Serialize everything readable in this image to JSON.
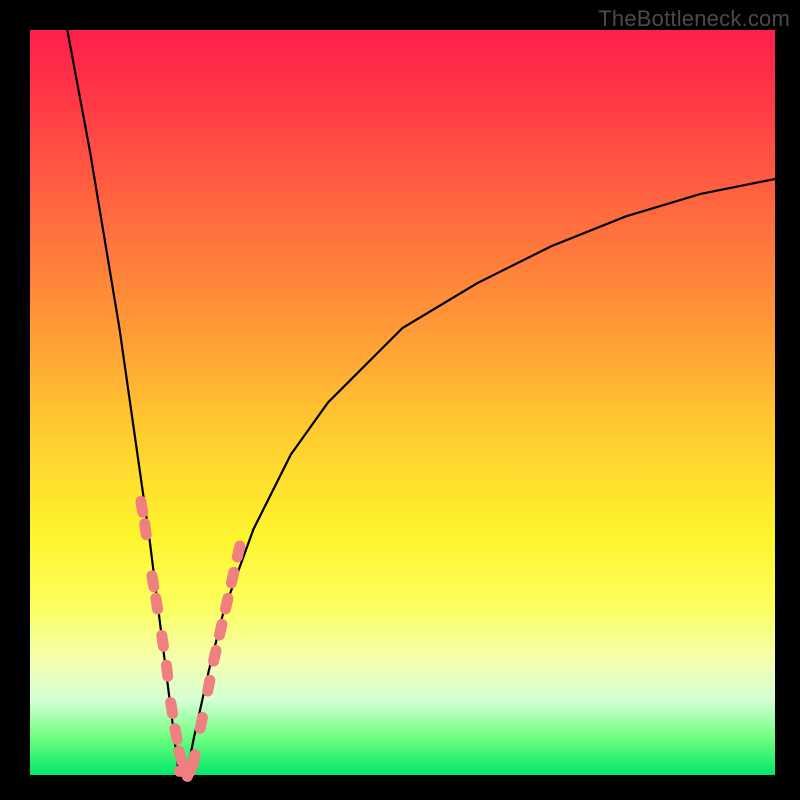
{
  "watermark": "TheBottleneck.com",
  "colors": {
    "frame": "#000000",
    "marker": "#f08080",
    "curve": "#000000",
    "gradient_top": "#ff1f4b",
    "gradient_bottom": "#00e66b"
  },
  "chart_data": {
    "type": "line",
    "title": "",
    "xlabel": "",
    "ylabel": "",
    "xlim": [
      0,
      100
    ],
    "ylim": [
      0,
      100
    ],
    "grid": false,
    "legend": false,
    "note": "V-shaped bottleneck curve; minimum at x≈20 where y≈0. Values at x<20 fall steeply from y≈100; values at x>20 rise toward y≈80 by x=100.",
    "series": [
      {
        "name": "bottleneck_curve",
        "x": [
          5,
          8,
          10,
          12,
          14,
          16,
          18,
          19,
          20,
          21,
          22,
          24,
          26,
          30,
          35,
          40,
          50,
          60,
          70,
          80,
          90,
          100
        ],
        "y": [
          100,
          84,
          72,
          60,
          46,
          32,
          16,
          8,
          0,
          0,
          5,
          14,
          22,
          33,
          43,
          50,
          60,
          66,
          71,
          75,
          78,
          80
        ]
      }
    ],
    "markers": {
      "name": "highlighted_points",
      "shape": "rounded-pill",
      "x": [
        15,
        15.5,
        16.5,
        17,
        17.8,
        18.4,
        19,
        19.6,
        20.2,
        20.8,
        21.4,
        22,
        23,
        24,
        24.8,
        25.6,
        26.4,
        27.2,
        28
      ],
      "y": [
        36,
        33,
        26,
        23,
        18,
        14,
        9,
        5.5,
        2.5,
        0.5,
        0.5,
        2,
        7,
        12,
        16,
        19.5,
        23,
        26.5,
        30
      ]
    }
  }
}
